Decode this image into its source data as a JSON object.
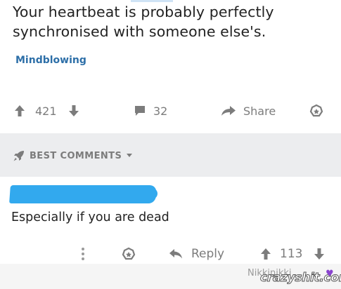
{
  "post": {
    "title": "Your heartbeat is probably perfectly synchronised with someone else's.",
    "flair": "Mindblowing",
    "upvotes": "421",
    "comments": "32",
    "share_label": "Share"
  },
  "comments_section": {
    "sort_label": "BEST COMMENTS"
  },
  "comment": {
    "text": "Especially if you are dead",
    "reply_label": "Reply",
    "score": "113"
  },
  "watermark": {
    "user": "Nikkinikki",
    "site": "crazyshit.com"
  },
  "colors": {
    "flair": "#2d6fa8",
    "icon_gray": "#7c7c7c",
    "redaction": "#32a9ee"
  }
}
